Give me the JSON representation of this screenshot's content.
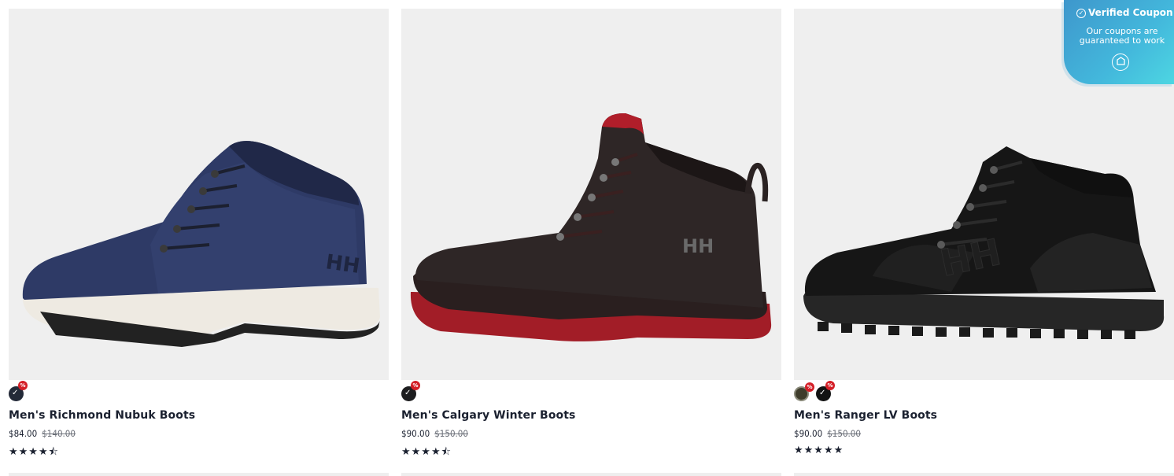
{
  "products": [
    {
      "name": "Men's Richmond Nubuk Boots",
      "price": "$84.00",
      "original_price": "$140.00",
      "rating": 4.5,
      "stars": "★★★★⯪",
      "swatches": [
        {
          "color": "#232a38",
          "selected": true,
          "on_sale": true
        }
      ]
    },
    {
      "name": "Men's Calgary Winter Boots",
      "price": "$90.00",
      "original_price": "$150.00",
      "rating": 4.5,
      "stars": "★★★★⯪",
      "swatches": [
        {
          "color": "#1d1d1f",
          "selected": true,
          "on_sale": true
        }
      ]
    },
    {
      "name": "Men's Ranger LV Boots",
      "price": "$90.00",
      "original_price": "$150.00",
      "rating": 5,
      "stars": "★★★★★",
      "swatches": [
        {
          "color": "#3f3d2c",
          "selected": false,
          "on_sale": true
        },
        {
          "color": "#121212",
          "selected": true,
          "on_sale": true
        }
      ]
    }
  ],
  "coupon": {
    "title": "Verified Coupon",
    "subtitle": "Our coupons are guaranteed to work",
    "icon": "coupon-shield-icon"
  },
  "icons": {
    "check": "✓",
    "sale": "%"
  },
  "colors": {
    "text": "#1b2130",
    "sale_badge": "#d41f27",
    "coupon_start": "#3e97cc",
    "coupon_end": "#4dd6e2"
  }
}
